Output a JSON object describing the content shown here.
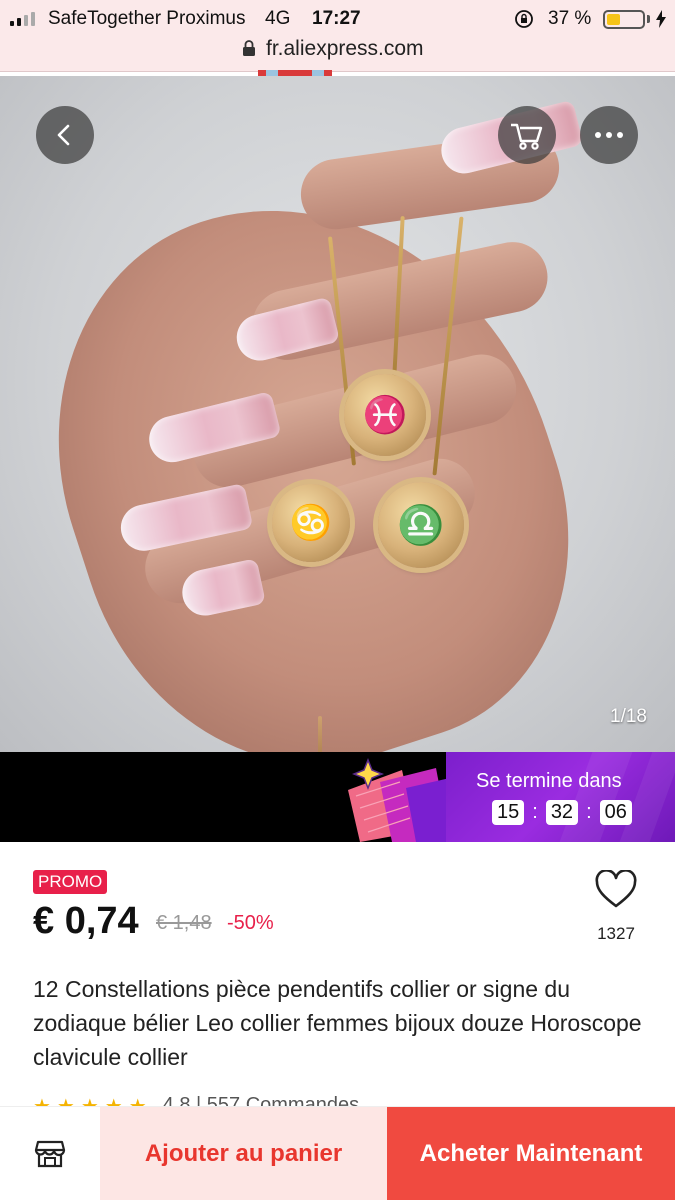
{
  "status_bar": {
    "carrier": "SafeTogether Proximus",
    "network": "4G",
    "time": "17:27",
    "battery_percent_text": "37 %",
    "battery_level": 0.37
  },
  "browser": {
    "url": "fr.aliexpress.com"
  },
  "gallery": {
    "counter": "1/18",
    "coin_labels": [
      "Pisces",
      "Cancer",
      "Libra"
    ]
  },
  "flash_deal": {
    "ends_label": "Se termine dans",
    "hours": "15",
    "minutes": "32",
    "seconds": "06",
    "separator": ":"
  },
  "product": {
    "badge": "PROMO",
    "price": "€ 0,74",
    "old_price": "€ 1,48",
    "discount": "-50%",
    "wishlist_count": "1327",
    "title": "12 Constellations pièce pendentifs collier or signe du zodiaque bélier Leo collier femmes bijoux douze Horoscope clavicule collier",
    "rating_text": "4.8 | 557 Commandes"
  },
  "actions": {
    "add_to_cart": "Ajouter au panier",
    "buy_now": "Acheter Maintenant"
  },
  "colors": {
    "accent_red": "#f04a40",
    "promo_red": "#e8204a",
    "deal_purple": "#7c1fcc",
    "battery_yellow": "#f6c419"
  }
}
